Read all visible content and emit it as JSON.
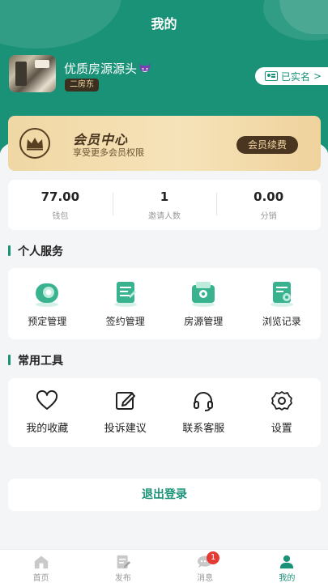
{
  "header": {
    "title": "我的"
  },
  "profile": {
    "username": "优质房源源头",
    "role": "二房东",
    "verify_label": "已实名",
    "verify_chevron": ">"
  },
  "vip": {
    "title": "会员中心",
    "subtitle": "享受更多会员权限",
    "button": "会员续费",
    "icon": "crown-icon"
  },
  "stats": [
    {
      "value": "77.00",
      "label": "钱包"
    },
    {
      "value": "1",
      "label": "邀请人数"
    },
    {
      "value": "0.00",
      "label": "分销"
    }
  ],
  "services": {
    "title": "个人服务",
    "items": [
      {
        "label": "预定管理",
        "icon": "booking-icon"
      },
      {
        "label": "签约管理",
        "icon": "contract-icon"
      },
      {
        "label": "房源管理",
        "icon": "listing-icon"
      },
      {
        "label": "浏览记录",
        "icon": "history-icon"
      }
    ]
  },
  "tools": {
    "title": "常用工具",
    "items": [
      {
        "label": "我的收藏",
        "icon": "heart-icon"
      },
      {
        "label": "投诉建议",
        "icon": "edit-icon"
      },
      {
        "label": "联系客服",
        "icon": "headset-icon"
      },
      {
        "label": "设置",
        "icon": "gear-icon"
      }
    ]
  },
  "logout_label": "退出登录",
  "tabbar": {
    "items": [
      {
        "label": "首页",
        "icon": "home-icon"
      },
      {
        "label": "发布",
        "icon": "publish-icon"
      },
      {
        "label": "消息",
        "icon": "message-icon",
        "badge": "1"
      },
      {
        "label": "我的",
        "icon": "user-icon",
        "active": true
      }
    ]
  },
  "colors": {
    "primary": "#1a9277",
    "vip_gold": "#f0d7a4",
    "vip_dark": "#4a3520",
    "badge_red": "#e53935"
  }
}
